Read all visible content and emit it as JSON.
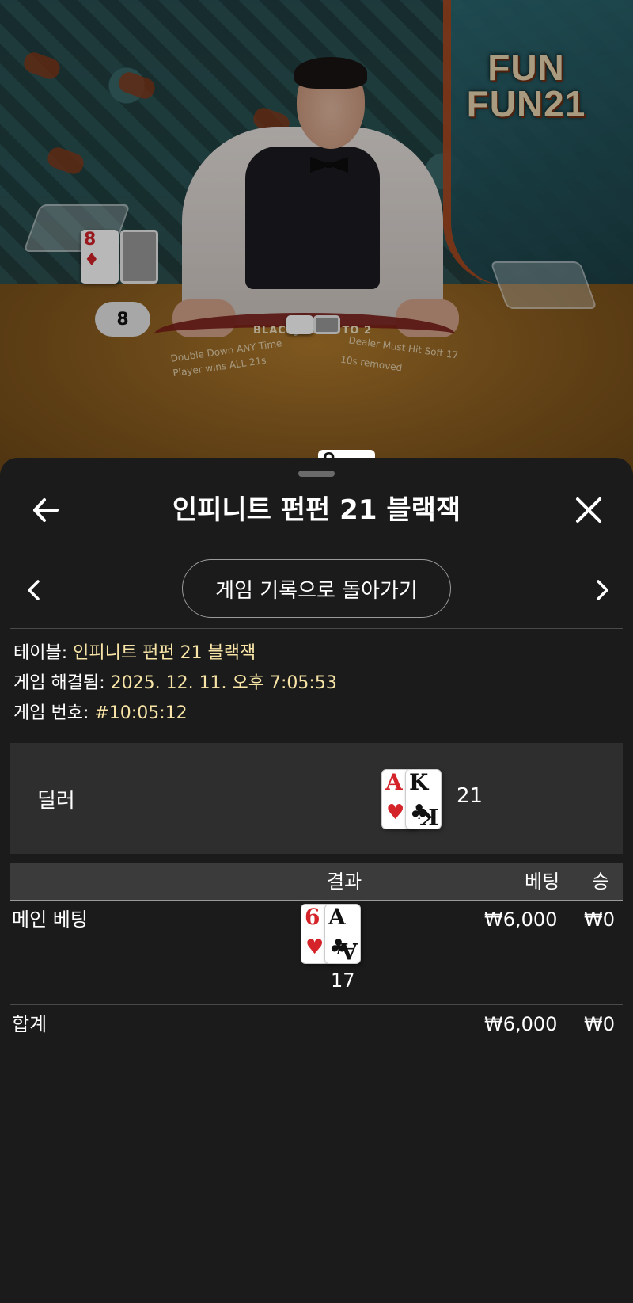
{
  "video": {
    "logo_line1": "FUN",
    "logo_line2": "FUN21",
    "dealer_score": "8",
    "felt_banner": "BLACKJACK 3 TO 2",
    "felt_left_1": "Double Down ANY Time",
    "felt_left_2": "Player wins ALL 21s",
    "felt_right_1": "Dealer Must Hit Soft 17",
    "felt_right_2": "10s removed",
    "bg_card_rank": "8",
    "peek_card_rank": "Q"
  },
  "header": {
    "title": "인피니트 펀펀 21 블랙잭",
    "back_icon": "arrow-left-icon",
    "close_icon": "close-icon"
  },
  "nav": {
    "back_to_history": "게임 기록으로 돌아가기",
    "prev_icon": "chevron-left-icon",
    "next_icon": "chevron-right-icon"
  },
  "info": {
    "table_label": "테이블: ",
    "table_value": "인피니트 펀펀 21 블랙잭",
    "resolved_label": "게임 해결됨: ",
    "resolved_value": "2025. 12. 11. 오후 7:05:53",
    "game_no_label": "게임 번호: ",
    "game_no_value": "#10:05:12"
  },
  "dealer": {
    "label": "딜러",
    "total": "21",
    "cards": [
      {
        "rank": "A",
        "suit": "♥",
        "color": "#d4242a"
      },
      {
        "rank": "K",
        "suit": "♣",
        "color": "#111111"
      }
    ]
  },
  "table": {
    "headers": {
      "result": "결과",
      "bet": "베팅",
      "win": "승"
    },
    "rows": [
      {
        "name": "메인 베팅",
        "cards": [
          {
            "rank": "6",
            "suit": "♥",
            "color": "#d4242a"
          },
          {
            "rank": "A",
            "suit": "♣",
            "color": "#111111"
          }
        ],
        "score": "17",
        "bet": "₩6,000",
        "win": "₩0"
      }
    ],
    "total": {
      "name": "합계",
      "bet": "₩6,000",
      "win": "₩0"
    }
  }
}
